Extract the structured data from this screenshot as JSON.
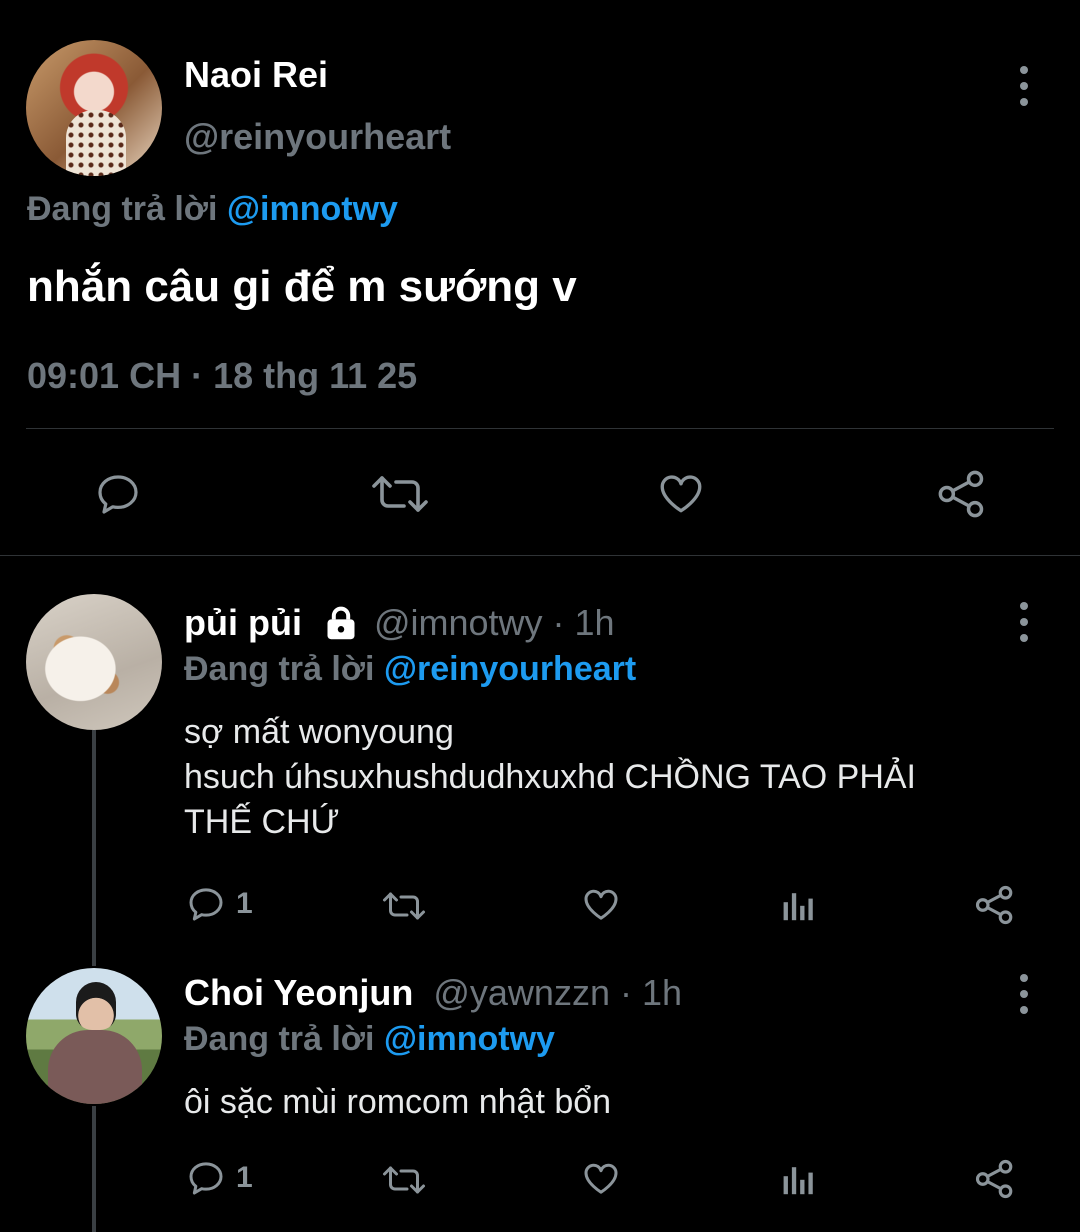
{
  "main_tweet": {
    "author_name": "Naoi Rei",
    "author_handle": "@reinyourheart",
    "replying_prefix": "Đang trả lời ",
    "replying_to": "@imnotwy",
    "text": "nhắn câu gi để m sướng v",
    "timestamp": "09:01 CH · 18 thg 11 25",
    "icons": {
      "reply": "reply-icon",
      "retweet": "retweet-icon",
      "like": "heart-icon",
      "share": "share-icon",
      "more": "more-vertical-icon"
    }
  },
  "replies": [
    {
      "author_name": "pủi pủi",
      "locked_icon": "lock-icon",
      "handle_time": "@imnotwy · 1h",
      "replying_prefix": "Đang trả lời ",
      "replying_to": "@reinyourheart",
      "text": "sợ mất wonyoung\nhsuch úhsuxhushdudhxuxhd CHỒNG TAO PHẢI\nTHẾ CHỨ",
      "reply_count": "1"
    },
    {
      "author_name": "Choi Yeonjun",
      "handle_time": "@yawnzzn · 1h",
      "replying_prefix": "Đang trả lời ",
      "replying_to": "@imnotwy",
      "text": "ôi sặc mùi romcom nhật bổn",
      "reply_count": "1"
    }
  ],
  "colors": {
    "background": "#000000",
    "accent": "#1d9bf0",
    "muted": "#6e767d"
  }
}
